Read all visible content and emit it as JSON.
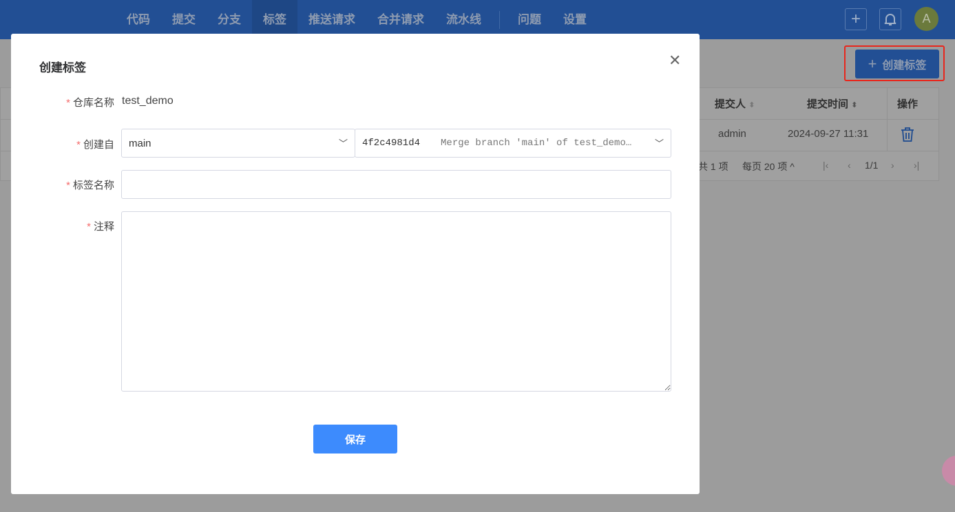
{
  "nav": {
    "items": [
      "代码",
      "提交",
      "分支",
      "标签",
      "推送请求",
      "合并请求",
      "流水线"
    ],
    "extra": [
      "问题",
      "设置"
    ],
    "active": "标签"
  },
  "topbar": {
    "avatar_letter": "A"
  },
  "page": {
    "create_tag_label": "创建标签"
  },
  "table": {
    "headers": {
      "committer": "提交人",
      "commit_time": "提交时间",
      "actions": "操作"
    },
    "rows": [
      {
        "committer": "admin",
        "commit_time": "2024-09-27 11:31"
      }
    ],
    "pager": {
      "total": "共 1 项",
      "per_page": "每页 20 项",
      "page": "1/1"
    }
  },
  "dialog": {
    "title": "创建标签",
    "repo_label": "仓库名称",
    "repo_value": "test_demo",
    "from_label": "创建自",
    "branch": "main",
    "commit_hash": "4f2c4981d4",
    "commit_msg": "Merge branch 'main' of test_demo…",
    "tag_name_label": "标签名称",
    "tag_name_value": "",
    "note_label": "注释",
    "note_value": "",
    "save_label": "保存"
  }
}
